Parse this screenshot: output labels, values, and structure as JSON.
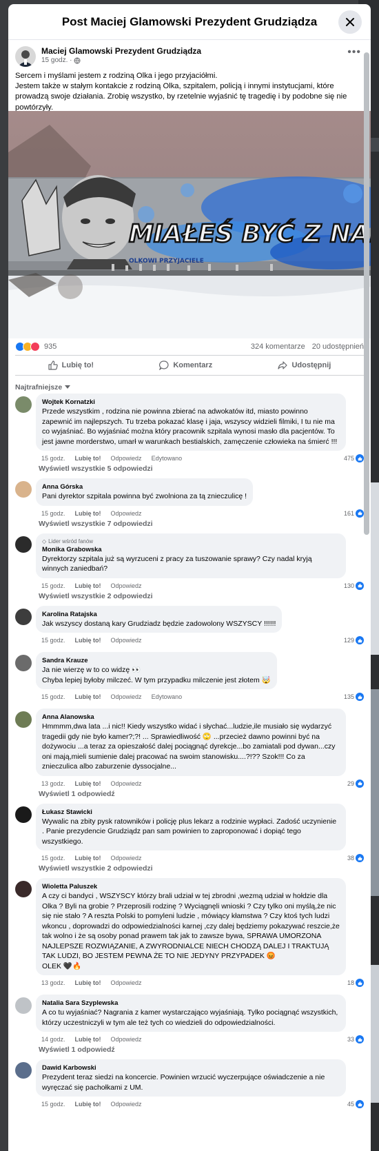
{
  "modal": {
    "title": "Post Maciej Glamowski Prezydent Grudziądza"
  },
  "post": {
    "author": "Maciej Glamowski Prezydent Grudziądza",
    "time": "15 godz. ·",
    "text_lines": [
      "Sercem i myślami jestem z rodziną Olka i jego przyjaciółmi.",
      "Jestem także w stałym kontakcie z rodziną Olka, szpitalem, policją i innymi instytucjami, które prowadzą swoje działania. Zrobię wszystko, by rzetelnie wyjaśnić tę tragedię i by podobne się nie powtórzyły."
    ],
    "mural_text_main": "MIAŁEŚ BYĆ Z NAMI",
    "mural_text_sub": "OLKOWI  PRZYJACIELE",
    "reaction_count": "935",
    "comment_count": "324 komentarze",
    "share_count": "20 udostępnień",
    "actions": {
      "like": "Lubię to!",
      "comment": "Komentarz",
      "share": "Udostępnij"
    },
    "sort_label": "Najtrafniejsze"
  },
  "colors": {
    "brand_blue": "#1877f2",
    "bubble": "#f0f2f5",
    "secondary_text": "#65676b"
  },
  "comments": [
    {
      "author": "Wojtek Kornatzki",
      "text": "Przede wszystkim , rodzina nie powinna zbierać na adwokatów itd, miasto powinno zapewnić im najlepszych. Tu trzeba pokazać klasę i jaja, wszyscy widzieli filmiki, I tu nie ma co wyjaśniać. Bo wyjaśniać można który pracownik szpitala wynosi masło dla pacjentów. To jest jawne morderstwo, umarł w warunkach bestialskich, zamęczenie człowieka na śmierć !!!",
      "time": "15 godz.",
      "like": "Lubię to!",
      "reply": "Odpowiedz",
      "edited": "Edytowano",
      "likes": "475",
      "replies": "Wyświetl wszystkie 5 odpowiedzi"
    },
    {
      "author": "Anna Górska",
      "text": "Pani dyrektor szpitala powinna być zwolniona za tą znieczulicę !",
      "time": "15 godz.",
      "like": "Lubię to!",
      "reply": "Odpowiedz",
      "likes": "161",
      "replies": "Wyświetl wszystkie 7 odpowiedzi"
    },
    {
      "badge": "Lider wśród fanów",
      "author": "Monika Grabowska",
      "text": "Dyrektorzy szpitala już są wyrzuceni z pracy za tuszowanie sprawy? Czy nadal kryją winnych zaniedbań?",
      "time": "15 godz.",
      "like": "Lubię to!",
      "reply": "Odpowiedz",
      "likes": "130",
      "replies": "Wyświetl wszystkie 2 odpowiedzi"
    },
    {
      "author": "Karolina Ratajska",
      "text": "Jak wszyscy dostaną kary Grudziadz będzie zadowolony WSZYSCY !!!!!!",
      "time": "15 godz.",
      "like": "Lubię to!",
      "reply": "Odpowiedz",
      "likes": "129"
    },
    {
      "author": "Sandra Krauze",
      "text": "Ja nie wierzę w to co widzę 👀\nChyba lepiej byłoby milczeć. W tym przypadku milczenie jest złotem 🤯",
      "time": "15 godz.",
      "like": "Lubię to!",
      "reply": "Odpowiedz",
      "edited": "Edytowano",
      "likes": "135"
    },
    {
      "author": "Anna Alanowska",
      "text": "Hmmmm,dwa lata ...i nic!! Kiedy wszystko widać i słychać...ludzie,ile musiało się wydarzyć tragedii gdy nie było kamer?;?! ... Sprawiedliwość 🙄 ...przecież dawno powinni być na dożywociu ...a teraz za opieszałość dalej pociągnąć dyrekcje...bo zamiatali pod dywan...czy oni mają,mieli sumienie dalej pracować na swoim stanowisku....?!?? Szok!!! Co za znieczulica albo zaburzenie dyssocjalne...",
      "time": "13 godz.",
      "like": "Lubię to!",
      "reply": "Odpowiedz",
      "likes": "29",
      "replies": "Wyświetl 1 odpowiedź"
    },
    {
      "author": "Łukasz Stawicki",
      "text": "Wywalic na zbity pysk ratowników i policję plus lekarz a rodzinie wypłaci. Zadość uczynienie . Panie prezydencie Grudziądz pan sam powinien to zaproponować i dopiąć tego wszystkiego.",
      "time": "15 godz.",
      "like": "Lubię to!",
      "reply": "Odpowiedz",
      "likes": "38",
      "replies": "Wyświetl wszystkie 2 odpowiedzi"
    },
    {
      "author": "Wioletta Paluszek",
      "text": "A czy ci bandyci , WSZYSCY którzy brali udział w tej zbrodni ,wezmą udział w hołdzie dla Olka ? Byli na grobie ? Przeprosili rodzinę ? Wyciągnęli wnioski ? Czy tylko oni myślą,że nic się nie stało ? A reszta Polski to pomyleni ludzie , mówiący kłamstwa ? Czy ktoś tych ludzi wkoncu , doprowadzi do odpowiedzialności karnej ,czy dalej będziemy pokazywać reszcie,że tak wolno i że są osoby ponad prawem tak jak to zawsze bywa, SPRAWA UMORZONA NAJLEPSZE ROZWIĄZANIE, A ZWYRODNIALCE NIECH CHODZĄ DALEJ I TRAKTUJĄ TAK LUDZI, BO JESTEM PEWNA ŻE TO NIE JEDYNY PRZYPADEK 😡\nOLEK 🖤🔥",
      "time": "13 godz.",
      "like": "Lubię to!",
      "reply": "Odpowiedz",
      "likes": "18"
    },
    {
      "author": "Natalia Sara Szyplewska",
      "text": "A co tu wyjaśniać? Nagrania z kamer wystarczająco wyjaśniają. Tylko pociągnąć wszystkich, którzy uczestniczyli w tym ale też tych co wiedzieli do odpowiedzialności.",
      "time": "14 godz.",
      "like": "Lubię to!",
      "reply": "Odpowiedz",
      "likes": "33",
      "replies": "Wyświetl 1 odpowiedź"
    },
    {
      "author": "Dawid Karbowski",
      "text": "Prezydent teraz siedzi na koncercie. Powinien wrzucić wyczerpujące oświadczenie a nie wyręczać się pachołkami z UM.",
      "time": "15 godz.",
      "like": "Lubię to!",
      "reply": "Odpowiedz",
      "likes": "45"
    }
  ]
}
